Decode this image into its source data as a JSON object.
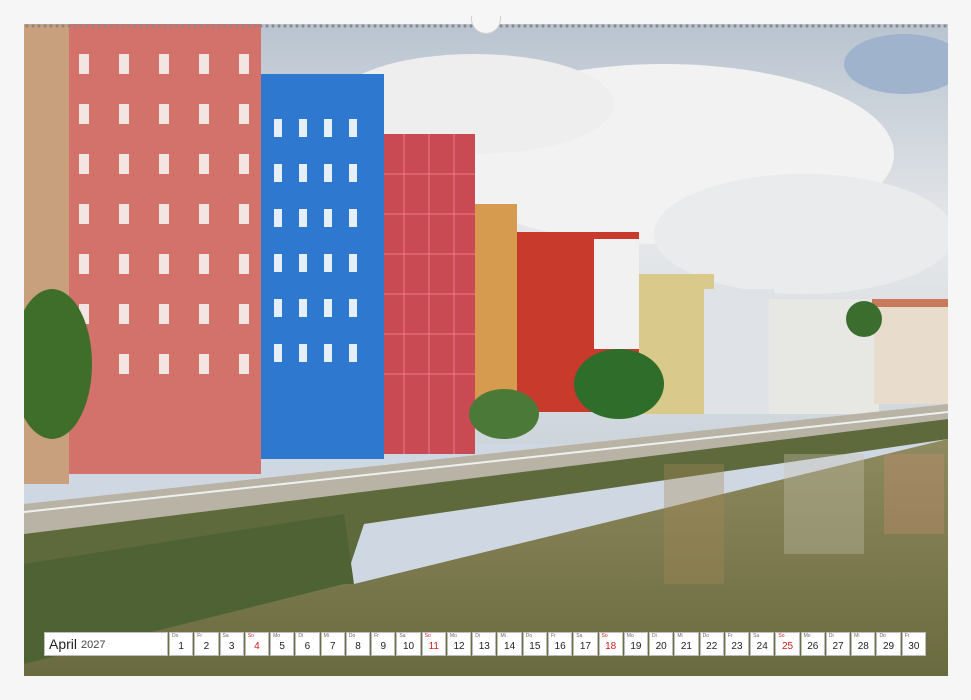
{
  "calendar": {
    "month": "April",
    "year": "2027",
    "sunday_color": "#d11a1a",
    "days": [
      {
        "wd": "Do",
        "d": "1"
      },
      {
        "wd": "Fr",
        "d": "2"
      },
      {
        "wd": "Sa",
        "d": "3"
      },
      {
        "wd": "So",
        "d": "4",
        "sun": true
      },
      {
        "wd": "Mo",
        "d": "5"
      },
      {
        "wd": "Di",
        "d": "6"
      },
      {
        "wd": "Mi",
        "d": "7"
      },
      {
        "wd": "Do",
        "d": "8"
      },
      {
        "wd": "Fr",
        "d": "9"
      },
      {
        "wd": "Sa",
        "d": "10"
      },
      {
        "wd": "So",
        "d": "11",
        "sun": true
      },
      {
        "wd": "Mo",
        "d": "12"
      },
      {
        "wd": "Di",
        "d": "13"
      },
      {
        "wd": "Mi",
        "d": "14"
      },
      {
        "wd": "Do",
        "d": "15"
      },
      {
        "wd": "Fr",
        "d": "16"
      },
      {
        "wd": "Sa",
        "d": "17"
      },
      {
        "wd": "So",
        "d": "18",
        "sun": true
      },
      {
        "wd": "Mo",
        "d": "19"
      },
      {
        "wd": "Di",
        "d": "20"
      },
      {
        "wd": "Mi",
        "d": "21"
      },
      {
        "wd": "Do",
        "d": "22"
      },
      {
        "wd": "Fr",
        "d": "23"
      },
      {
        "wd": "Sa",
        "d": "24"
      },
      {
        "wd": "So",
        "d": "25",
        "sun": true
      },
      {
        "wd": "Mo",
        "d": "26"
      },
      {
        "wd": "Di",
        "d": "27"
      },
      {
        "wd": "Mi",
        "d": "28"
      },
      {
        "wd": "Do",
        "d": "29"
      },
      {
        "wd": "Fr",
        "d": "30"
      }
    ]
  },
  "photo": {
    "subject": "riverside-buildings-photo",
    "colors": {
      "sky": "#c9d3de",
      "river": "#7a7a4c",
      "wall": "#6f7350"
    }
  }
}
